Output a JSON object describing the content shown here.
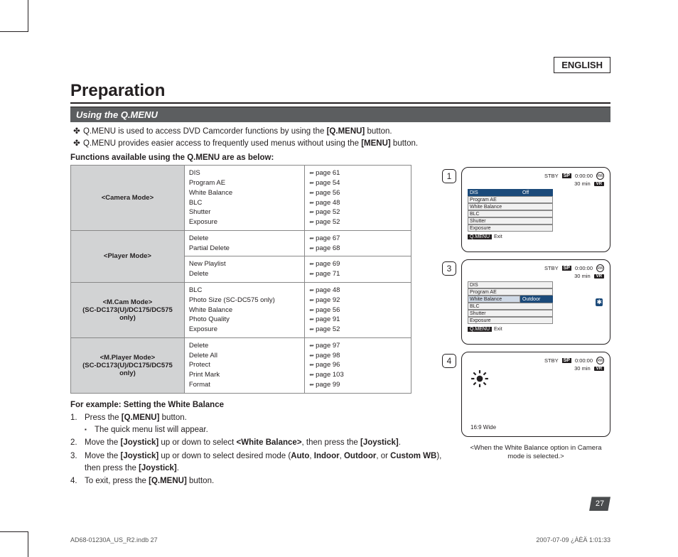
{
  "lang": "ENGLISH",
  "title": "Preparation",
  "section": "Using the Q.MENU",
  "intro": {
    "b1a": "Q.MENU is used to access DVD Camcorder functions by using the ",
    "b1b": "[Q.MENU]",
    "b1c": " button.",
    "b2a": "Q.MENU provides easier access to frequently used menus without using the ",
    "b2b": "[MENU]",
    "b2c": " button."
  },
  "funcs": "Functions available using the Q.MENU are as below:",
  "table": [
    {
      "mode": "<Camera Mode>",
      "items": [
        "DIS",
        "Program AE",
        "White Balance",
        "BLC",
        "Shutter",
        "Exposure"
      ],
      "pages": [
        "page 61",
        "page 54",
        "page 56",
        "page 48",
        "page 52",
        "page 52"
      ]
    },
    {
      "mode": "<Player Mode>",
      "blocks": [
        {
          "items": [
            "Delete",
            "Partial Delete"
          ],
          "pages": [
            "page 67",
            "page 68"
          ]
        },
        {
          "items": [
            "New Playlist",
            "Delete"
          ],
          "pages": [
            "page 69",
            "page 71"
          ]
        }
      ]
    },
    {
      "mode": "<M.Cam Mode>\n(SC-DC173(U)/DC175/DC575 only)",
      "items": [
        "BLC",
        "Photo Size (SC-DC575 only)",
        "White Balance",
        "Photo Quality",
        "Exposure"
      ],
      "pages": [
        "page 48",
        "page 92",
        "page 56",
        "page 91",
        "page 52"
      ]
    },
    {
      "mode": "<M.Player Mode>\n(SC-DC173(U)/DC175/DC575 only)",
      "items": [
        "Delete",
        "Delete All",
        "Protect",
        "Print Mark",
        "Format"
      ],
      "pages": [
        "page 97",
        "page 98",
        "page 96",
        "page 103",
        "page 99"
      ]
    }
  ],
  "example": {
    "hd": "For example: Setting the White Balance",
    "s1a": "Press the ",
    "s1b": "[Q.MENU]",
    "s1c": " button.",
    "s1s": "The quick menu list will appear.",
    "s2a": "Move the ",
    "s2b": "[Joystick]",
    "s2c": " up or down to select ",
    "s2d": "<White Balance>",
    "s2e": ", then press the ",
    "s2f": "[Joystick]",
    "s2g": ".",
    "s3a": "Move the ",
    "s3b": "[Joystick]",
    "s3c": " up or down to select desired mode (",
    "s3d": "Auto",
    "s3e": ", ",
    "s3f": "Indoor",
    "s3g": ", ",
    "s3h": "Outdoor",
    "s3i": ", or ",
    "s3j": "Custom WB",
    "s3k": "), then press the ",
    "s3l": "[Joystick]",
    "s3m": ".",
    "s4a": "To exit, press the ",
    "s4b": "[Q.MENU]",
    "s4c": " button."
  },
  "panels": {
    "stby": "STBY",
    "sp": "SP",
    "time": "0:00:00",
    "disc": "RW",
    "rem": "30 min",
    "vr": "VR",
    "menu": {
      "rows": [
        "DIS",
        "Program AE",
        "White Balance",
        "BLC",
        "Shutter",
        "Exposure"
      ],
      "val_off": "Off",
      "val_outdoor": "Outdoor"
    },
    "exit_qm": "Q.MENU",
    "exit": "Exit",
    "wide": "16:9 Wide",
    "caption": "<When the White Balance option in Camera mode is selected.>"
  },
  "pagenum": "27",
  "footer": {
    "left": "AD68-01230A_US_R2.indb   27",
    "right": "2007-07-09   ¿ÀÈÄ 1:01:33"
  }
}
